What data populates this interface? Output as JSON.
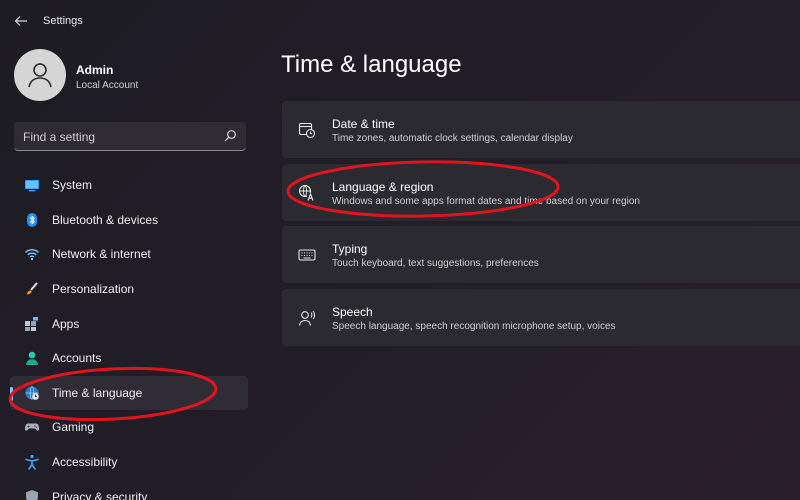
{
  "app": {
    "title": "Settings"
  },
  "user": {
    "name": "Admin",
    "account_type": "Local Account"
  },
  "search": {
    "placeholder": "Find a setting"
  },
  "sidebar": {
    "items": [
      {
        "label": "System",
        "icon": "monitor-icon"
      },
      {
        "label": "Bluetooth & devices",
        "icon": "bluetooth-icon"
      },
      {
        "label": "Network & internet",
        "icon": "wifi-icon"
      },
      {
        "label": "Personalization",
        "icon": "brush-icon"
      },
      {
        "label": "Apps",
        "icon": "apps-icon"
      },
      {
        "label": "Accounts",
        "icon": "person-icon"
      },
      {
        "label": "Time & language",
        "icon": "globe-clock-icon",
        "active": true
      },
      {
        "label": "Gaming",
        "icon": "gamepad-icon"
      },
      {
        "label": "Accessibility",
        "icon": "accessibility-icon"
      },
      {
        "label": "Privacy & security",
        "icon": "shield-icon"
      }
    ]
  },
  "main": {
    "title": "Time & language",
    "cards": [
      {
        "title": "Date & time",
        "description": "Time zones, automatic clock settings, calendar display",
        "icon": "calendar-clock-icon"
      },
      {
        "title": "Language & region",
        "description": "Windows and some apps format dates and time based on your region",
        "icon": "language-icon"
      },
      {
        "title": "Typing",
        "description": "Touch keyboard, text suggestions, preferences",
        "icon": "keyboard-icon"
      },
      {
        "title": "Speech",
        "description": "Speech language, speech recognition microphone setup, voices",
        "icon": "speech-icon"
      }
    ]
  },
  "colors": {
    "accent": "#7dc8ff",
    "annotation": "#e0141e",
    "card_bg": "#2c2a31"
  }
}
